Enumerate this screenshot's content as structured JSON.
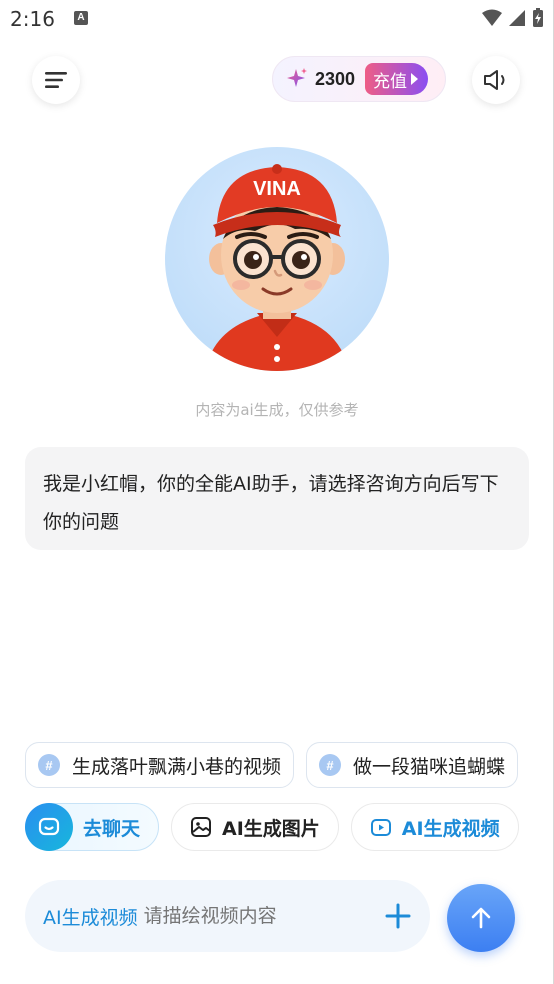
{
  "status_bar": {
    "time": "2:16",
    "notification_letter": "A"
  },
  "header": {
    "credits": "2300",
    "recharge_label": "充值"
  },
  "avatar": {
    "cap_text": "VINA"
  },
  "disclaimer": "内容为ai生成，仅供参考",
  "message": "我是小红帽，你的全能AI助手，请选择咨询方向后写下你的问题",
  "suggestions": [
    {
      "label": "生成落叶飘满小巷的视频"
    },
    {
      "label": "做一段猫咪追蝴蝶"
    }
  ],
  "modes": [
    {
      "label": "去聊天",
      "icon": "chat-icon",
      "active": true
    },
    {
      "label": "AI生成图片",
      "icon": "image-icon",
      "active": false
    },
    {
      "label": "AI生成视频",
      "icon": "video-icon",
      "active": false
    }
  ],
  "input": {
    "mode_label": "AI生成视频",
    "placeholder": "请描绘视频内容"
  },
  "colors": {
    "accent_blue": "#1c8bd8",
    "send_button": "#4a8bf4",
    "recharge_gradient_start": "#ee5d86",
    "recharge_gradient_end": "#8a4ef2"
  }
}
